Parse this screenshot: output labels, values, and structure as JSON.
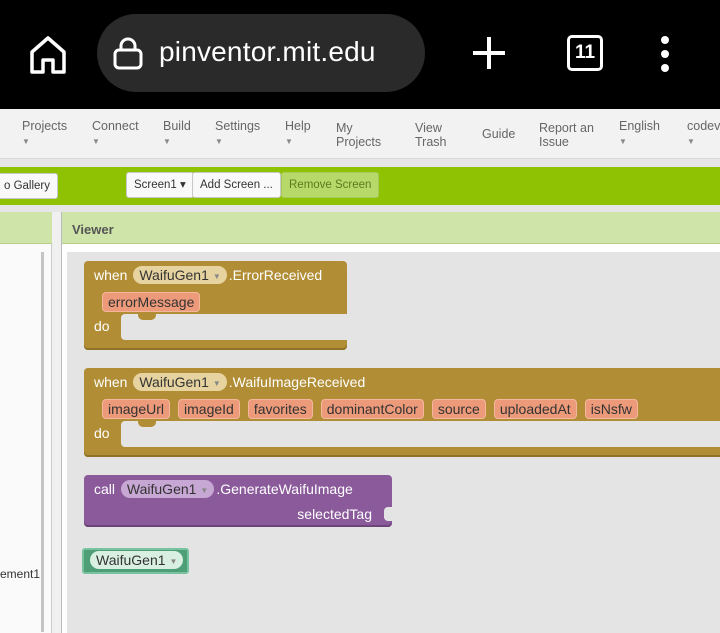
{
  "browser": {
    "url": "pinventor.mit.edu",
    "tab_count": "11",
    "icons": [
      "home-icon",
      "lock-icon",
      "plus-icon",
      "tabs-icon",
      "more-vert-icon"
    ]
  },
  "menu": {
    "projects": "Projects",
    "connect": "Connect",
    "build": "Build",
    "settings": "Settings",
    "help": "Help",
    "my_projects_1": "My",
    "my_projects_2": "Projects",
    "view_trash_1": "View",
    "view_trash_2": "Trash",
    "guide": "Guide",
    "report_1": "Report an",
    "report_2": "Issue",
    "english": "English",
    "codev": "codev"
  },
  "toolbar": {
    "gallery": "o Gallery",
    "screen_select": "Screen1 ▾",
    "add_screen": "Add Screen ...",
    "remove_screen": "Remove Screen"
  },
  "left_panel": {
    "partial_label": "ement1"
  },
  "viewer": {
    "title": "Viewer"
  },
  "blocks": {
    "error_event": {
      "when": "when",
      "component": "WaifuGen1",
      "event": ".ErrorReceived",
      "params": [
        "errorMessage"
      ],
      "do": "do"
    },
    "image_event": {
      "when": "when",
      "component": "WaifuGen1",
      "event": ".WaifuImageReceived",
      "params": [
        "imageUrl",
        "imageId",
        "favorites",
        "dominantColor",
        "source",
        "uploadedAt",
        "isNsfw"
      ],
      "do": "do"
    },
    "generate_call": {
      "call": "call",
      "component": "WaifuGen1",
      "method": ".GenerateWaifuImage",
      "arg": "selectedTag"
    },
    "component_block": {
      "component": "WaifuGen1"
    }
  },
  "colors": {
    "toolbar_green": "#8fc202",
    "event_block": "#b18e35",
    "procedure_block": "#8a5a9b",
    "component_block": "#4e9e78",
    "param_block": "#ec9a7a"
  }
}
